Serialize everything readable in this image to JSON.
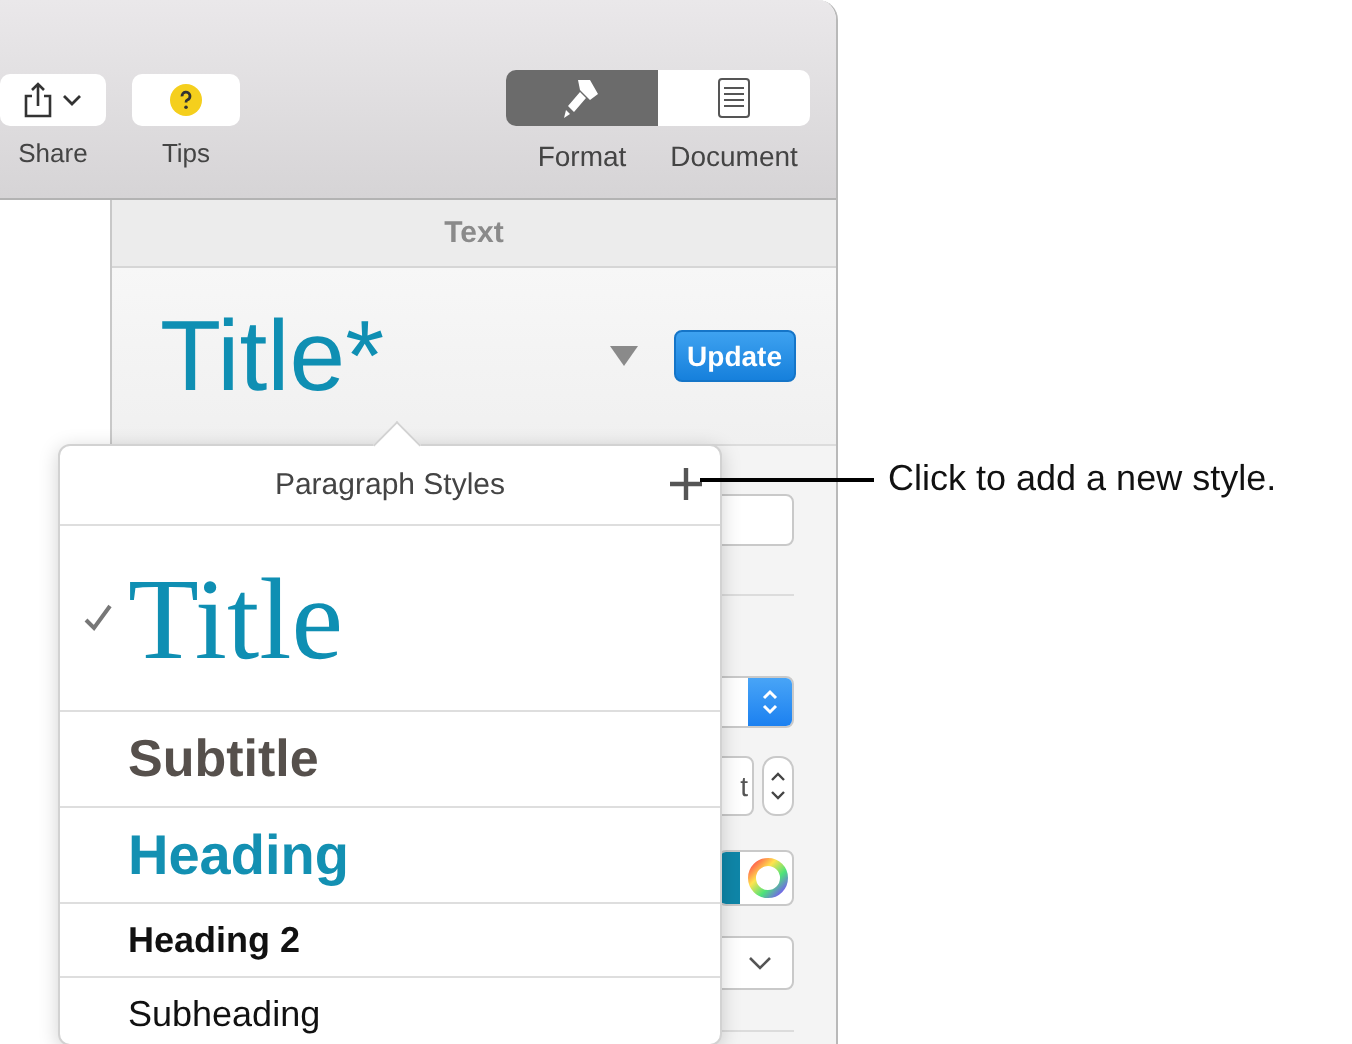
{
  "toolbar": {
    "items": [
      {
        "label": "Share",
        "kind": "share"
      },
      {
        "label": "Tips",
        "kind": "tips"
      }
    ],
    "view_switcher": [
      {
        "label": "Format",
        "kind": "format",
        "selected": true
      },
      {
        "label": "Document",
        "kind": "document",
        "selected": false
      }
    ]
  },
  "sidebar": {
    "header": "Text",
    "current_style": "Title*",
    "update_button": "Update",
    "partial_unit": "t"
  },
  "popover": {
    "title": "Paragraph Styles",
    "styles": [
      {
        "label": "Title",
        "kind": "title",
        "selected": true
      },
      {
        "label": "Subtitle",
        "kind": "subtitle",
        "selected": false
      },
      {
        "label": "Heading",
        "kind": "heading",
        "selected": false
      },
      {
        "label": "Heading 2",
        "kind": "heading2",
        "selected": false
      },
      {
        "label": "Subheading",
        "kind": "subheading",
        "selected": false
      }
    ]
  },
  "callout": "Click to add a new style."
}
